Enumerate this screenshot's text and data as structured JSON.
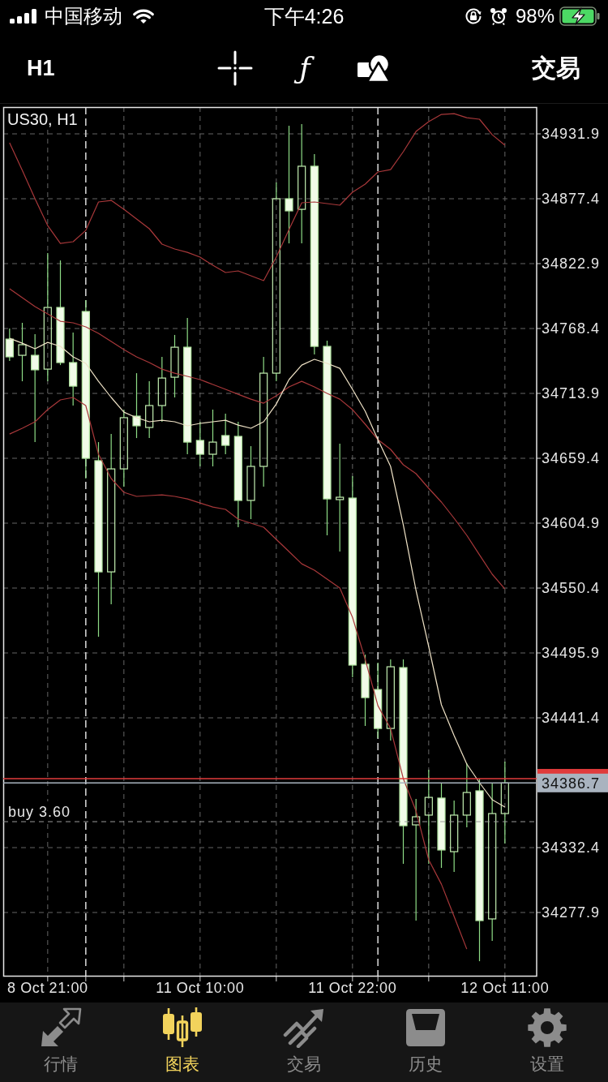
{
  "status_bar": {
    "carrier": "中国移动",
    "time": "下午4:26",
    "battery": "98%"
  },
  "toolbar": {
    "timeframe": "H1",
    "function_symbol": "ƒ",
    "trade": "交易"
  },
  "chart": {
    "chart_data": {
      "type": "candlestick",
      "title": "US30, H1",
      "grid": true,
      "categories": [
        null,
        null,
        null,
        "8 Oct 21:00",
        null,
        null,
        null,
        null,
        null,
        null,
        null,
        null,
        null,
        null,
        null,
        "11 Oct 10:00",
        null,
        null,
        null,
        null,
        null,
        null,
        null,
        null,
        null,
        null,
        null,
        "11 Oct 22:00",
        null,
        null,
        null,
        null,
        null,
        null,
        null,
        null,
        null,
        null,
        null,
        "12 Oct 11:00",
        null,
        null
      ],
      "ylim": [
        34224.1,
        34954.4
      ],
      "yticks": [
        34931.9,
        34877.4,
        34822.9,
        34768.4,
        34713.9,
        34659.4,
        34604.9,
        34550.4,
        34495.9,
        34441.4,
        34332.4,
        34277.9
      ],
      "ohlc": [
        [
          34759.5,
          34768.4,
          34741.2,
          34744.6
        ],
        [
          34745.9,
          34773.2,
          34724.1,
          34754.8
        ],
        [
          34745.9,
          34763.6,
          34673.0,
          34733.7
        ],
        [
          34734.3,
          34831.8,
          34724.1,
          34786.1
        ],
        [
          34786.1,
          34825.6,
          34737.7,
          34739.8
        ],
        [
          34739.8,
          34765.0,
          34703.7,
          34720.0
        ],
        [
          34782.7,
          34792.2,
          34642.4,
          34659.4
        ],
        [
          34657.4,
          34673.0,
          34509.5,
          34564.0
        ],
        [
          34564.0,
          34679.8,
          34536.8,
          34650.5
        ],
        [
          34650.5,
          34700.3,
          34635.6,
          34693.5
        ],
        [
          34694.8,
          34730.9,
          34676.4,
          34686.7
        ],
        [
          34685.3,
          34724.1,
          34676.4,
          34703.7
        ],
        [
          34703.7,
          34744.6,
          34690.1,
          34726.8
        ],
        [
          34727.5,
          34763.0,
          34710.5,
          34752.7
        ],
        [
          34752.7,
          34777.3,
          34662.8,
          34673.0
        ],
        [
          34674.4,
          34690.1,
          34652.6,
          34662.8
        ],
        [
          34662.8,
          34700.3,
          34652.6,
          34673.0
        ],
        [
          34678.5,
          34696.9,
          34662.8,
          34670.3
        ],
        [
          34677.8,
          34690.1,
          34601.5,
          34624.0
        ],
        [
          34624.0,
          34669.6,
          34608.3,
          34652.6
        ],
        [
          34652.6,
          34744.6,
          34635.6,
          34730.9
        ],
        [
          34730.9,
          34891.0,
          34724.1,
          34877.4
        ],
        [
          34877.4,
          34938.7,
          34839.9,
          34867.2
        ],
        [
          34868.5,
          34940.1,
          34839.9,
          34904.7
        ],
        [
          34904.7,
          34914.9,
          34746.6,
          34753.4
        ],
        [
          34753.4,
          34758.2,
          34594.7,
          34625.3
        ],
        [
          34624.7,
          34671.7,
          34581.1,
          34626.7
        ],
        [
          34626.0,
          34644.4,
          34475.5,
          34485.7
        ],
        [
          34486.4,
          34494.5,
          34434.6,
          34458.4
        ],
        [
          34465.2,
          34487.7,
          34424.4,
          34432.5
        ],
        [
          34432.5,
          34490.5,
          34422.3,
          34484.3
        ],
        [
          34483.6,
          34490.5,
          34318.8,
          34350.8
        ],
        [
          34351.5,
          34373.3,
          34271.1,
          34358.3
        ],
        [
          34359.7,
          34397.8,
          34318.8,
          34374.6
        ],
        [
          34374.0,
          34386.9,
          34315.4,
          34330.4
        ],
        [
          34329.0,
          34371.9,
          34312.0,
          34359.7
        ],
        [
          34359.7,
          34403.3,
          34349.4,
          34378.7
        ],
        [
          34380.1,
          34390.3,
          34237.0,
          34271.1
        ],
        [
          34272.5,
          34386.9,
          34254.1,
          34361.0
        ],
        [
          34361.0,
          34404.6,
          34335.8,
          34386.7
        ],
        null,
        null
      ],
      "series": [
        {
          "type": "line",
          "color": "#a8383a",
          "values": [
            34924.4,
            34901.2,
            34877.4,
            34854.9,
            34839.9,
            34841.3,
            34850.8,
            34874.7,
            34876.0,
            34868.5,
            34860.4,
            34852.2,
            34839.3,
            34835.2,
            34832.4,
            34828.4,
            34821.5,
            34815.4,
            34816.8,
            34812.7,
            34808.6,
            34828.4,
            34851.5,
            34874.0,
            34874.7,
            34873.3,
            34872.0,
            34882.9,
            34889.7,
            34899.9,
            34901.9,
            34916.9,
            34933.9,
            34942.1,
            34948.2,
            34948.9,
            34945.5,
            34944.2,
            34931.2,
            34922.4,
            null,
            null
          ]
        },
        {
          "type": "line",
          "color": "#a8383a",
          "values": [
            34801.8,
            34794.3,
            34786.8,
            34780.7,
            34774.5,
            34773.2,
            34769.8,
            34764.3,
            34757.5,
            34750.7,
            34744.6,
            34739.8,
            34734.3,
            34730.9,
            34728.2,
            34725.5,
            34721.4,
            34717.3,
            34713.2,
            34709.1,
            34705.7,
            34711.9,
            34719.4,
            34724.1,
            34719.4,
            34713.9,
            34709.1,
            34700.3,
            34688.0,
            34675.1,
            34666.9,
            34654.0,
            34646.5,
            34634.2,
            34622.6,
            34609.0,
            34594.7,
            34578.3,
            34562.0,
            34549.7,
            null,
            null
          ]
        },
        {
          "type": "line",
          "color": "#a8383a",
          "values": [
            34679.8,
            34684.6,
            34690.1,
            34700.3,
            34708.5,
            34710.5,
            34703.7,
            34662.8,
            34642.4,
            34630.8,
            34627.4,
            34628.1,
            34628.7,
            34627.4,
            34625.3,
            34621.9,
            34618.5,
            34616.5,
            34608.3,
            34604.9,
            34601.5,
            34591.3,
            34581.1,
            34570.8,
            34565.4,
            34557.9,
            34550.4,
            34525.9,
            34490.5,
            34451.6,
            34432.5,
            34390.3,
            34363.1,
            34322.2,
            34301.7,
            34274.5,
            34247.2,
            null,
            null,
            null,
            null,
            null
          ]
        },
        {
          "type": "line",
          "color": "#efe2c6",
          "values": [
            34760.2,
            34756.1,
            34751.4,
            34756.8,
            34753.4,
            34744.6,
            34739.1,
            34724.1,
            34710.5,
            34698.2,
            34693.5,
            34690.1,
            34691.4,
            34690.1,
            34686.7,
            34688.7,
            34690.1,
            34691.4,
            34687.3,
            34684.6,
            34690.1,
            34705.0,
            34725.5,
            34737.7,
            34742.5,
            34739.1,
            34735.0,
            34717.3,
            34698.9,
            34675.1,
            34652.6,
            34603.5,
            34548.4,
            34501.4,
            34452.3,
            34426.4,
            34402.6,
            34386.9,
            34372.6,
            34366.5,
            null,
            null
          ]
        }
      ],
      "ref_lines": [
        {
          "axis": "y",
          "value": 34390.3,
          "color": "#e03b3b"
        },
        {
          "axis": "y",
          "value": 34386.7,
          "label": "34386.7",
          "color": "#a9b3bf"
        },
        {
          "axis": "y",
          "value": 34354.2,
          "label": "buy 3.60",
          "color": "#9a9a9a"
        }
      ]
    }
  },
  "tabs": [
    {
      "label": "行情",
      "selected": false
    },
    {
      "label": "图表",
      "selected": true
    },
    {
      "label": "交易",
      "selected": false
    },
    {
      "label": "历史",
      "selected": false
    },
    {
      "label": "设置",
      "selected": false
    }
  ]
}
